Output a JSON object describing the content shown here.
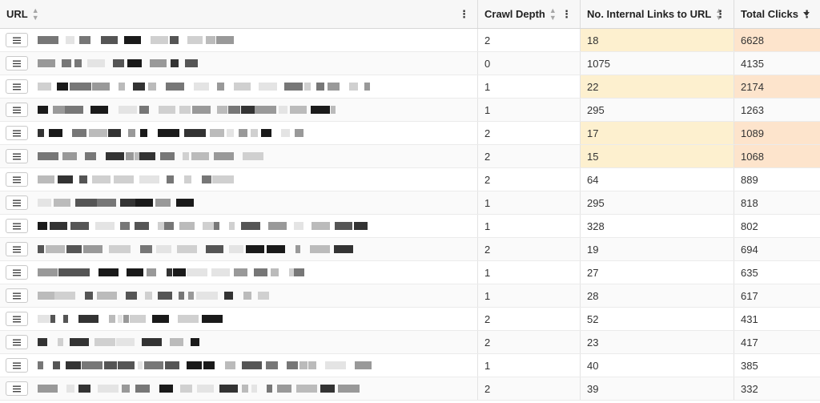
{
  "columns": {
    "url": "URL",
    "crawl_depth": "Crawl Depth",
    "internal_links": "No. Internal Links to URL",
    "total_clicks": "Total Clicks"
  },
  "sort": {
    "column": "total_clicks",
    "direction": "descending"
  },
  "highlight_colors": {
    "links": "#fdf0cf",
    "clicks": "#fde4cc"
  },
  "rows": [
    {
      "depth": "2",
      "links": "18",
      "clicks": "6628",
      "highlight": true
    },
    {
      "depth": "0",
      "links": "1075",
      "clicks": "4135",
      "highlight": false
    },
    {
      "depth": "1",
      "links": "22",
      "clicks": "2174",
      "highlight": true
    },
    {
      "depth": "1",
      "links": "295",
      "clicks": "1263",
      "highlight": false
    },
    {
      "depth": "2",
      "links": "17",
      "clicks": "1089",
      "highlight": true
    },
    {
      "depth": "2",
      "links": "15",
      "clicks": "1068",
      "highlight": true
    },
    {
      "depth": "2",
      "links": "64",
      "clicks": "889",
      "highlight": false
    },
    {
      "depth": "1",
      "links": "295",
      "clicks": "818",
      "highlight": false
    },
    {
      "depth": "1",
      "links": "328",
      "clicks": "802",
      "highlight": false
    },
    {
      "depth": "2",
      "links": "19",
      "clicks": "694",
      "highlight": false
    },
    {
      "depth": "1",
      "links": "27",
      "clicks": "635",
      "highlight": false
    },
    {
      "depth": "1",
      "links": "28",
      "clicks": "617",
      "highlight": false
    },
    {
      "depth": "2",
      "links": "52",
      "clicks": "431",
      "highlight": false
    },
    {
      "depth": "2",
      "links": "23",
      "clicks": "417",
      "highlight": false
    },
    {
      "depth": "1",
      "links": "40",
      "clicks": "385",
      "highlight": false
    },
    {
      "depth": "2",
      "links": "39",
      "clicks": "332",
      "highlight": false
    }
  ]
}
